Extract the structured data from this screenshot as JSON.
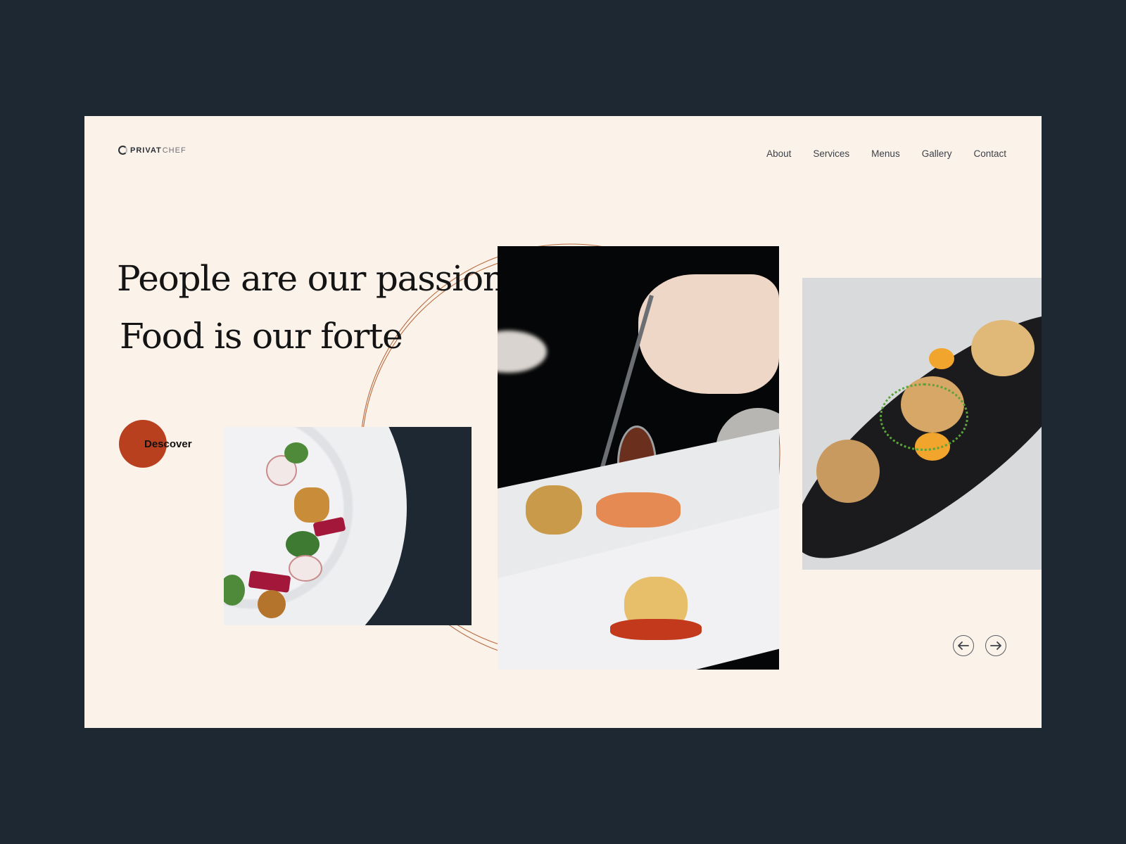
{
  "brand": {
    "name_bold": "PRIVAT",
    "name_light": "CHEF",
    "icon": "ring-logo-icon"
  },
  "nav": {
    "items": [
      {
        "label": "About"
      },
      {
        "label": "Services"
      },
      {
        "label": "Menus"
      },
      {
        "label": "Gallery"
      },
      {
        "label": "Contact"
      }
    ]
  },
  "hero": {
    "line1": "People are our passion",
    "line2": "Food is our forte",
    "cta_label": "Descover"
  },
  "gallery": {
    "images": [
      {
        "alt": "Plated salad with radish, beet and greens"
      },
      {
        "alt": "Chef plating dish with spoon"
      },
      {
        "alt": "Seared scallops on black risotto"
      }
    ],
    "prev_icon": "arrow-left-icon",
    "next_icon": "arrow-right-icon"
  },
  "colors": {
    "background": "#1d2833",
    "page": "#fbf2ea",
    "accent": "#b9401f",
    "arc": "#b86a3e"
  }
}
